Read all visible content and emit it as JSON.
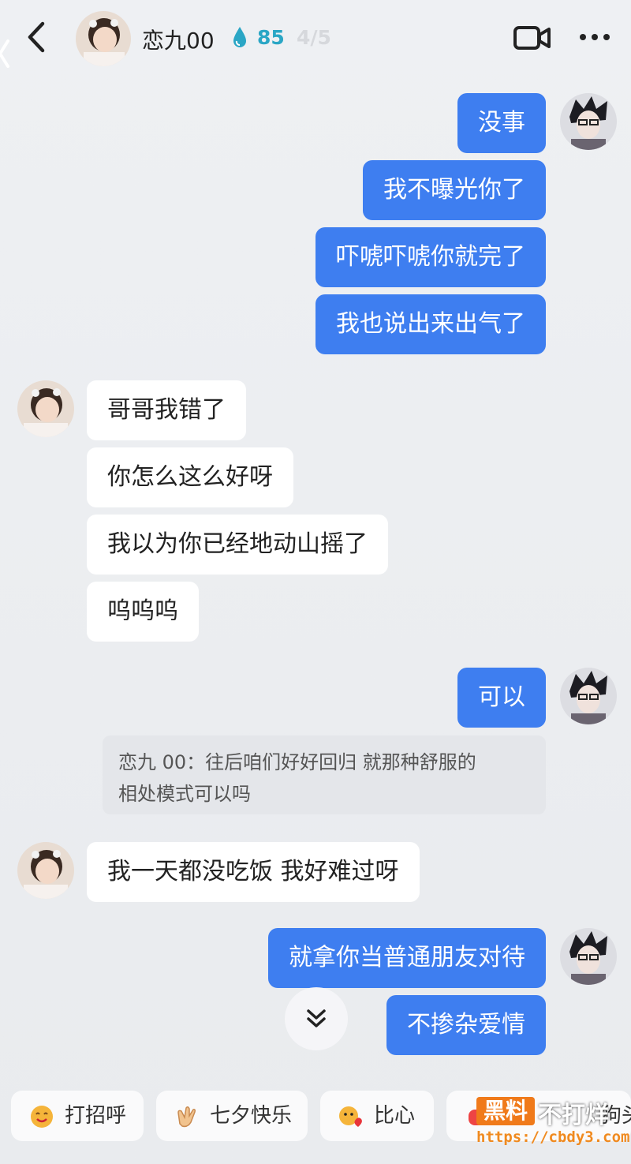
{
  "header": {
    "contact_name": "恋九00",
    "intimacy_value": "85",
    "pager": "4/5"
  },
  "messages": [
    {
      "side": "out",
      "text": "没事"
    },
    {
      "side": "out",
      "text": "我不曝光你了"
    },
    {
      "side": "out",
      "text": "吓唬吓唬你就完了"
    },
    {
      "side": "out",
      "text": "我也说出来出气了"
    },
    {
      "side": "in",
      "text": "哥哥我错了"
    },
    {
      "side": "in",
      "text": "你怎么这么好呀"
    },
    {
      "side": "in",
      "text": "我以为你已经地动山摇了"
    },
    {
      "side": "in",
      "text": "呜呜呜"
    },
    {
      "side": "out",
      "text": "可以"
    },
    {
      "side": "in",
      "text": "我一天都没吃饭 我好难过呀"
    },
    {
      "side": "out",
      "text": "就拿你当普通朋友对待"
    },
    {
      "side": "out",
      "text": "不掺杂爱情"
    }
  ],
  "quote": {
    "line1": "恋九 00：往后咱们好好回归 就那种舒服的",
    "line2": "相处模式可以吗"
  },
  "quick_replies": [
    {
      "label": "打招呼",
      "icon": "wave-emoji-icon"
    },
    {
      "label": "七夕快乐",
      "icon": "clap-emoji-icon"
    },
    {
      "label": "比心",
      "icon": "heart-hand-emoji-icon"
    },
    {
      "label": "狗头",
      "icon": "dog-emoji-icon"
    }
  ],
  "watermark": {
    "badge": "黑料",
    "text": "不打烊",
    "url": "https://cbdy3.com"
  },
  "colors": {
    "outgoing_bubble": "#3e7ef0",
    "incoming_bubble": "#ffffff",
    "intimacy": "#2aa6c5",
    "watermark": "#f07a1a"
  }
}
